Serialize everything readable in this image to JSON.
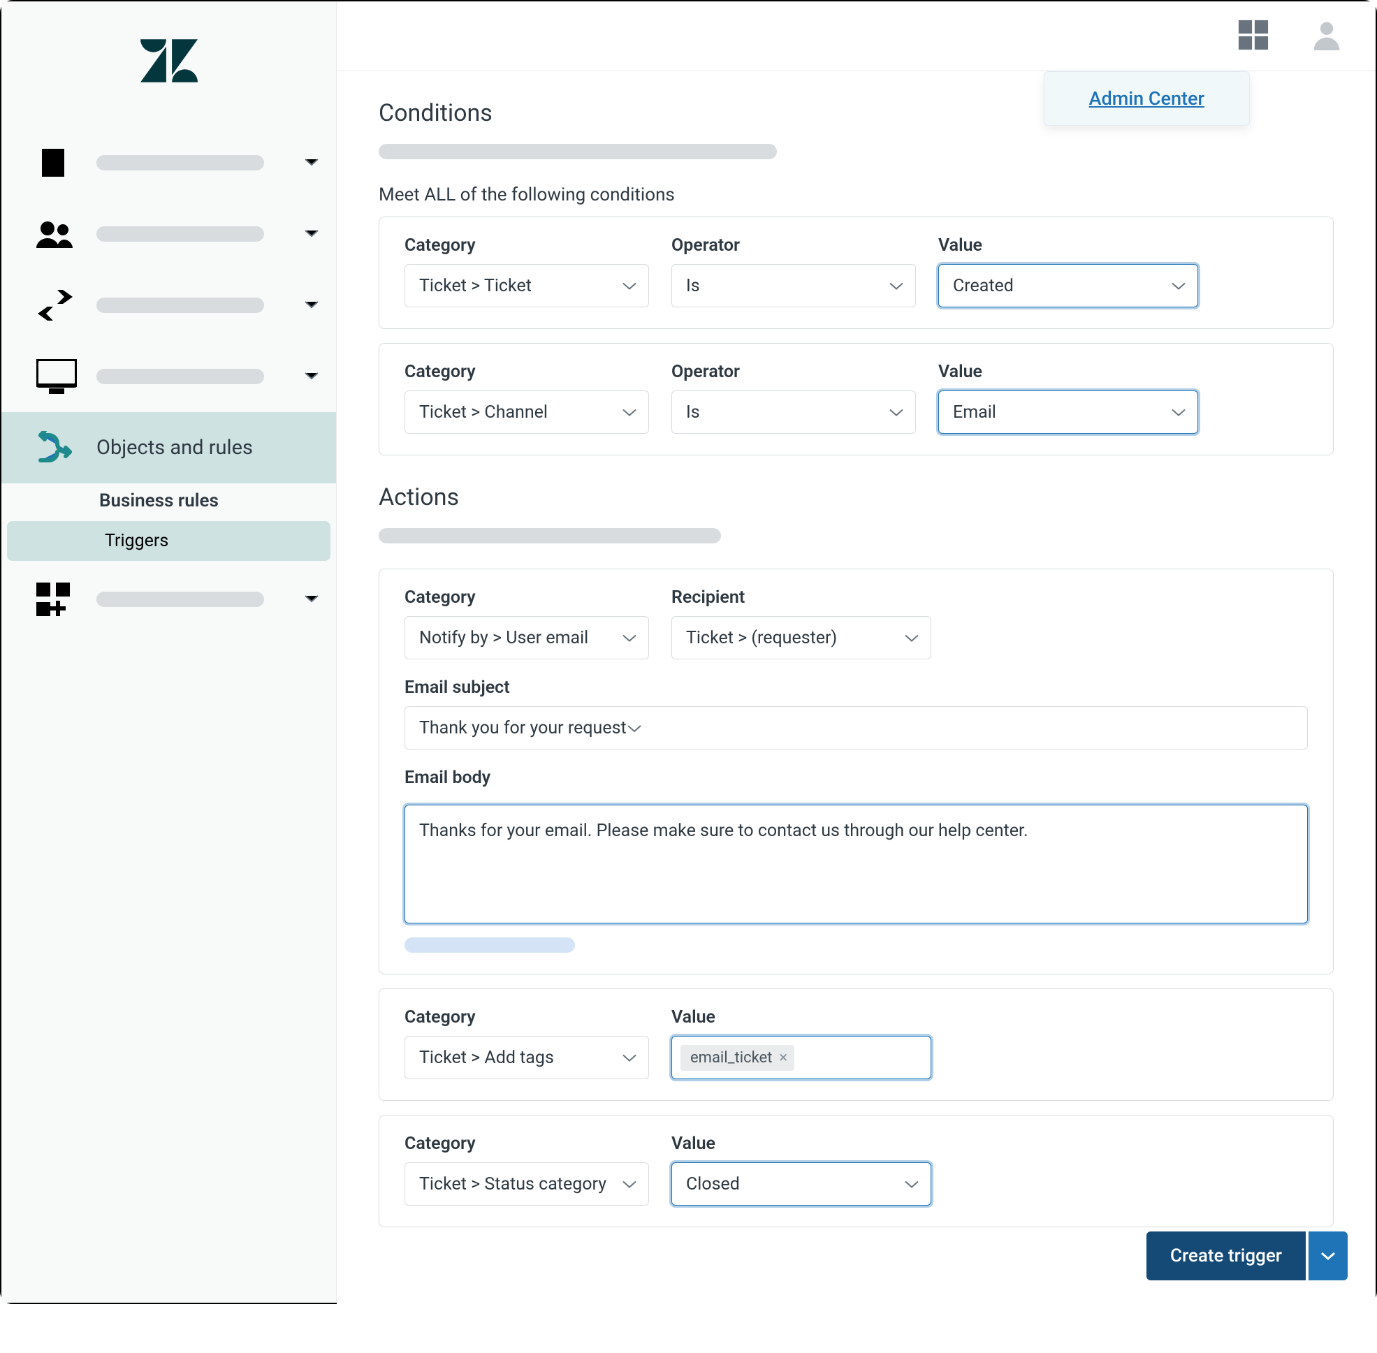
{
  "sidebar": {
    "active_label": "Objects and rules",
    "sub_section": "Business rules",
    "sub_item": "Triggers"
  },
  "topbar": {
    "admin_center": "Admin Center"
  },
  "conditions": {
    "title": "Conditions",
    "all_label": "Meet ALL of the following conditions",
    "rows": [
      {
        "category_label": "Category",
        "category_value": "Ticket > Ticket",
        "operator_label": "Operator",
        "operator_value": "Is",
        "value_label": "Value",
        "value_value": "Created"
      },
      {
        "category_label": "Category",
        "category_value": "Ticket > Channel",
        "operator_label": "Operator",
        "operator_value": "Is",
        "value_label": "Value",
        "value_value": "Email"
      }
    ]
  },
  "actions": {
    "title": "Actions",
    "notify": {
      "category_label": "Category",
      "category_value": "Notify by > User email",
      "recipient_label": "Recipient",
      "recipient_value": "Ticket > (requester)",
      "subject_label": "Email subject",
      "subject_value": "Thank you for your request",
      "body_label": "Email body",
      "body_value": "Thanks for your email. Please make sure to contact us through our help center."
    },
    "tags": {
      "category_label": "Category",
      "category_value": "Ticket > Add tags",
      "value_label": "Value",
      "tag": "email_ticket"
    },
    "status": {
      "category_label": "Category",
      "category_value": "Ticket > Status category",
      "value_label": "Value",
      "value_value": "Closed"
    }
  },
  "footer": {
    "create": "Create trigger"
  }
}
